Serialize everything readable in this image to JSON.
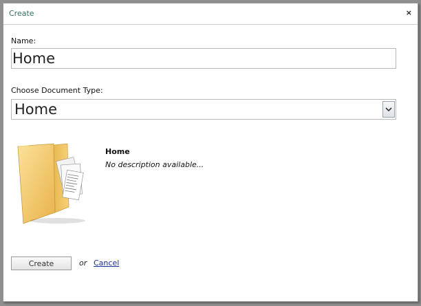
{
  "dialog": {
    "title": "Create",
    "close_label": "×"
  },
  "form": {
    "name_label": "Name:",
    "name_value": "Home",
    "doctype_label": "Choose Document Type:",
    "doctype_selected": "Home",
    "doctype_arrow_icon": "chevron-down-icon"
  },
  "preview": {
    "icon": "folder-icon",
    "title": "Home",
    "description": "No description available..."
  },
  "actions": {
    "create_label": "Create",
    "or_text": "or",
    "cancel_label": "Cancel"
  },
  "colors": {
    "title": "#2f6f5f",
    "link": "#1a2e9a",
    "folder": "#f2c25c"
  }
}
